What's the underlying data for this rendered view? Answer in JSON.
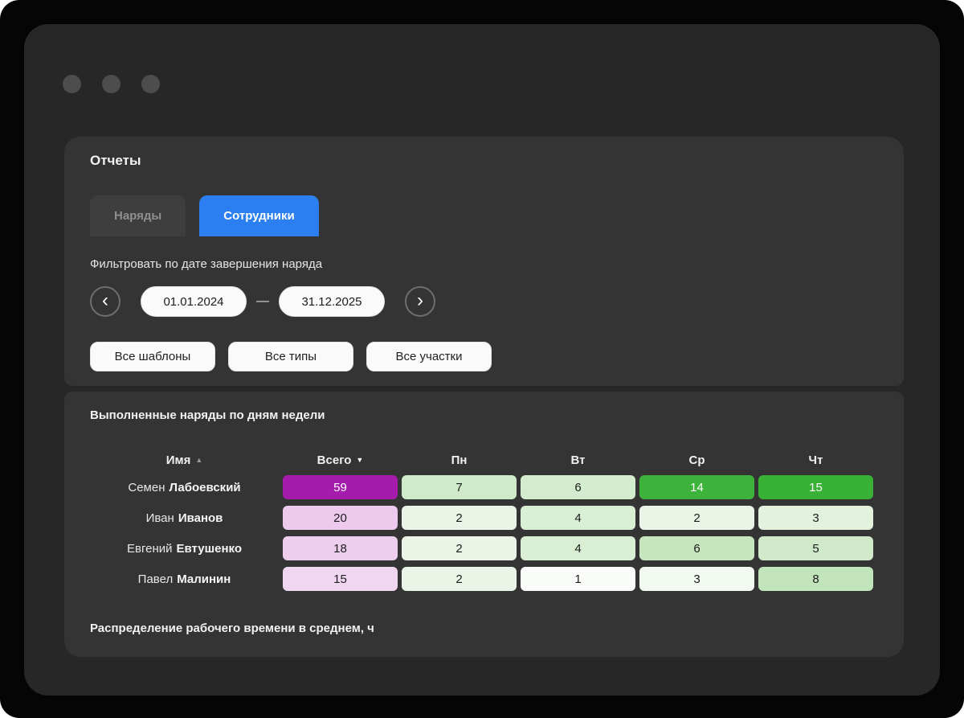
{
  "colors": {
    "accent": "#2b7ff0"
  },
  "report": {
    "title": "Отчеты",
    "tabs": [
      {
        "label": "Наряды",
        "active": false
      },
      {
        "label": "Сотрудники",
        "active": true
      }
    ]
  },
  "filters": {
    "date_label": "Фильтровать по дате завершения наряда",
    "date_from": "01.01.2024",
    "date_separator": "—",
    "date_to": "31.12.2025",
    "prev_icon": "‹",
    "next_icon": "›",
    "dropdowns": [
      {
        "label": "Все шаблоны"
      },
      {
        "label": "Все типы"
      },
      {
        "label": "Все участки"
      }
    ]
  },
  "weekday_section": {
    "title": "Выполненные наряды по дням недели",
    "header": {
      "name_label": "Имя",
      "name_sort_icon": "▲",
      "total_label": "Всего",
      "total_sort_icon": "▼",
      "day_labels": [
        "Пн",
        "Вт",
        "Ср",
        "Чт"
      ]
    },
    "rows": [
      {
        "first_name": "Семен",
        "last_name": "Лабоевский",
        "cells": [
          {
            "value": "59",
            "bg": "#a51bac",
            "fg": "#ffffff"
          },
          {
            "value": "7",
            "bg": "#cfeac8",
            "fg": "#1c1c1c"
          },
          {
            "value": "6",
            "bg": "#d4ecce",
            "fg": "#1c1c1c"
          },
          {
            "value": "14",
            "bg": "#3eb33b",
            "fg": "#ffffff"
          },
          {
            "value": "15",
            "bg": "#39b136",
            "fg": "#ffffff"
          }
        ]
      },
      {
        "first_name": "Иван",
        "last_name": "Иванов",
        "cells": [
          {
            "value": "20",
            "bg": "#edc9ed",
            "fg": "#1c1c1c"
          },
          {
            "value": "2",
            "bg": "#eaf5e7",
            "fg": "#1c1c1c"
          },
          {
            "value": "4",
            "bg": "#d9efd3",
            "fg": "#1c1c1c"
          },
          {
            "value": "2",
            "bg": "#eaf5e7",
            "fg": "#1c1c1c"
          },
          {
            "value": "3",
            "bg": "#e2f2dd",
            "fg": "#1c1c1c"
          }
        ]
      },
      {
        "first_name": "Евгений",
        "last_name": "Евтушенко",
        "cells": [
          {
            "value": "18",
            "bg": "#eeceee",
            "fg": "#1c1c1c"
          },
          {
            "value": "2",
            "bg": "#eaf5e7",
            "fg": "#1c1c1c"
          },
          {
            "value": "4",
            "bg": "#d9efd3",
            "fg": "#1c1c1c"
          },
          {
            "value": "6",
            "bg": "#c6e6be",
            "fg": "#1c1c1c"
          },
          {
            "value": "5",
            "bg": "#d0eac9",
            "fg": "#1c1c1c"
          }
        ]
      },
      {
        "first_name": "Павел",
        "last_name": "Малинин",
        "cells": [
          {
            "value": "15",
            "bg": "#f1d6f1",
            "fg": "#1c1c1c"
          },
          {
            "value": "2",
            "bg": "#eaf5e7",
            "fg": "#1c1c1c"
          },
          {
            "value": "1",
            "bg": "#f9fcf8",
            "fg": "#1c1c1c"
          },
          {
            "value": "3",
            "bg": "#f2f9f0",
            "fg": "#1c1c1c"
          },
          {
            "value": "8",
            "bg": "#c2e4ba",
            "fg": "#1c1c1c"
          }
        ]
      }
    ]
  },
  "time_section": {
    "title": "Распределение рабочего времени в среднем, ч"
  }
}
